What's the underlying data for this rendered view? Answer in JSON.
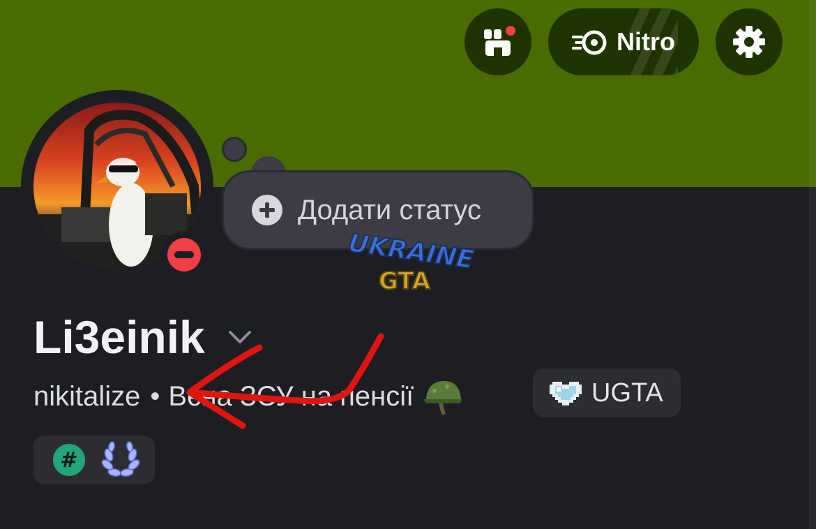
{
  "header": {
    "nitro_label": "Nitro",
    "banner_color": "#4a6b00",
    "button_bg": "#1f3300",
    "notification_dot_color": "#f23f43"
  },
  "status_bubble": {
    "label": "Додати статус",
    "icon": "plus-circle-icon"
  },
  "watermark": {
    "line1": "UKRAINE",
    "line2": "GTA"
  },
  "profile": {
    "display_name": "Li3einik",
    "username": "nikitalize",
    "separator": "•",
    "bio": "Вєна ЗСУ на пенсії",
    "status": "do-not-disturb",
    "status_color": "#f23f43"
  },
  "server_tag": {
    "label": "UGTA",
    "icon": "pixel-heart-icon"
  },
  "badges": [
    {
      "icon": "hashtag-badge-icon",
      "text": "#",
      "color": "#23a57c"
    },
    {
      "icon": "laurel-badge-icon",
      "color": "#8fa1ff"
    }
  ],
  "annotation_color": "#e0150e"
}
